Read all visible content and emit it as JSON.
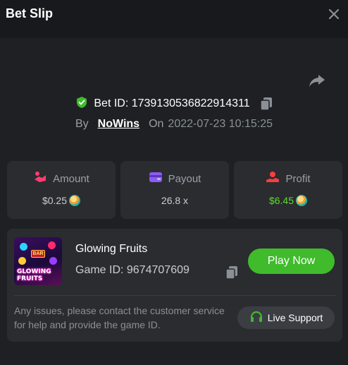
{
  "header": {
    "title": "Bet Slip"
  },
  "bet": {
    "id_label": "Bet ID: 1739130536822914311",
    "by_label": "By",
    "user": "NoWins",
    "on_label": "On",
    "date": "2022-07-23 10:15:25"
  },
  "stats": {
    "amount": {
      "label": "Amount",
      "value": "$0.25",
      "icon": "amount-icon"
    },
    "payout": {
      "label": "Payout",
      "value": "26.8 x",
      "icon": "wallet-icon"
    },
    "profit": {
      "label": "Profit",
      "value": "$6.45",
      "icon": "profit-icon"
    }
  },
  "game": {
    "name": "Glowing Fruits",
    "id_label": "Game ID: 9674707609",
    "thumb_text_1": "GLOWING",
    "thumb_text_2": "FRUITS",
    "thumb_bar": "BAR",
    "play_label": "Play Now"
  },
  "support": {
    "notice": "Any issues, please contact the customer service for help and provide the game ID.",
    "button_label": "Live Support"
  },
  "colors": {
    "accent_green": "#3fbb2c",
    "profit_green": "#5ddc2a",
    "background": "#1e2023",
    "card": "#2a2c30"
  }
}
